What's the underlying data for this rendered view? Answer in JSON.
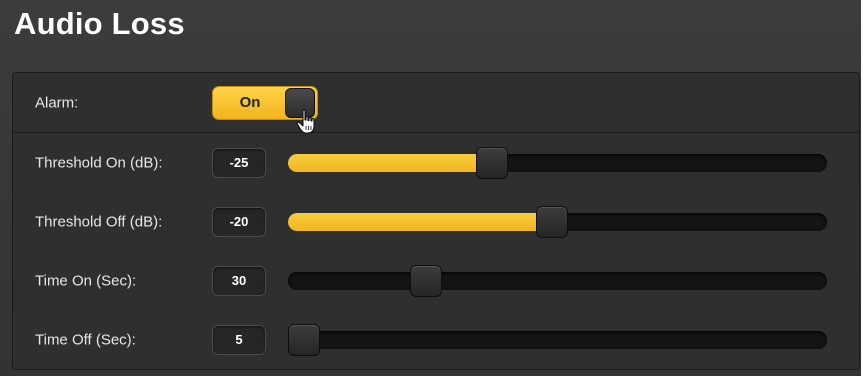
{
  "title": "Audio Loss",
  "alarm": {
    "label": "Alarm:",
    "state": "On"
  },
  "sliders": [
    {
      "label": "Threshold On (dB):",
      "value": "-25",
      "level": 0.37
    },
    {
      "label": "Threshold Off (dB):",
      "value": "-20",
      "level": 0.49
    },
    {
      "label": "Time On (Sec):",
      "value": "30",
      "level": 0.24
    },
    {
      "label": "Time Off (Sec):",
      "value": "5",
      "level": 0.0
    }
  ],
  "colors": {
    "accent": "#f4bf2a",
    "panel": "#2d2d2d",
    "track": "#141414"
  },
  "icons": {
    "cursor": "hand-pointer-icon"
  }
}
